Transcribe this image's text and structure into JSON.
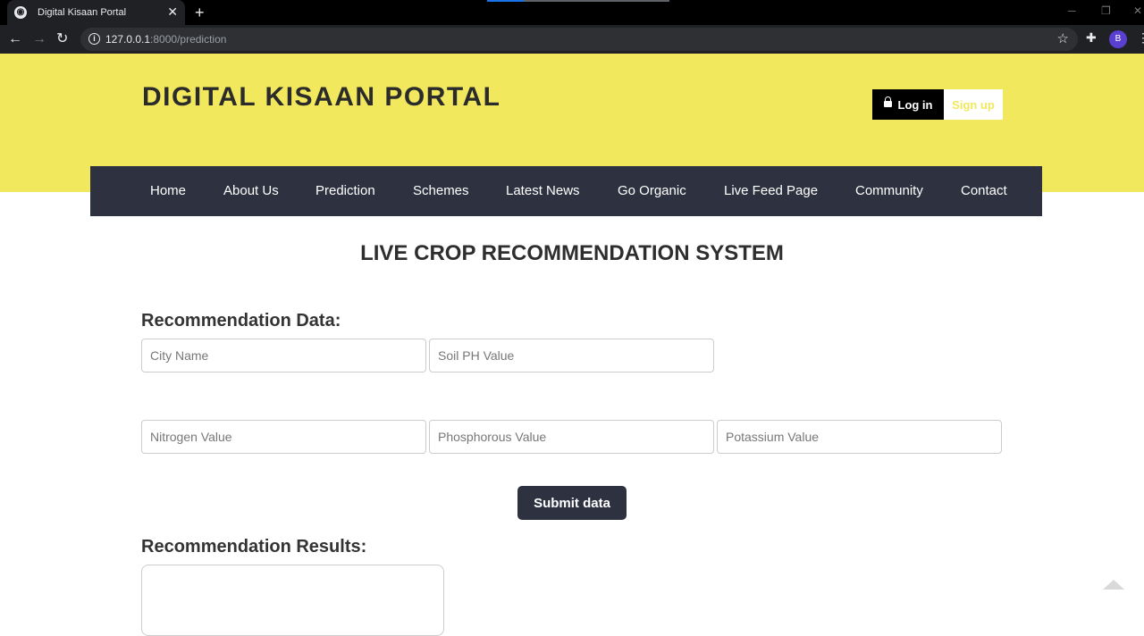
{
  "browser": {
    "tab_title": "Digital Kisaan Portal",
    "url_host": "127.0.0.1",
    "url_rest": ":8000/prediction",
    "profile_initial": "B"
  },
  "header": {
    "brand": "DIGITAL KISAAN PORTAL",
    "login_label": "Log in",
    "signup_label": "Sign up"
  },
  "nav": [
    "Home",
    "About Us",
    "Prediction",
    "Schemes",
    "Latest News",
    "Go Organic",
    "Live Feed Page",
    "Community",
    "Contact"
  ],
  "main": {
    "title": "LIVE CROP RECOMMENDATION SYSTEM",
    "data_heading": "Recommendation Data:",
    "fields": {
      "city": "City Name",
      "ph": "Soil PH Value",
      "nitrogen": "Nitrogen Value",
      "phosphorous": "Phosphorous Value",
      "potassium": "Potassium Value"
    },
    "submit_label": "Submit data",
    "results_heading": "Recommendation Results:"
  },
  "colors": {
    "hero_bg": "#f1e85d",
    "nav_bg": "#2e3240"
  }
}
